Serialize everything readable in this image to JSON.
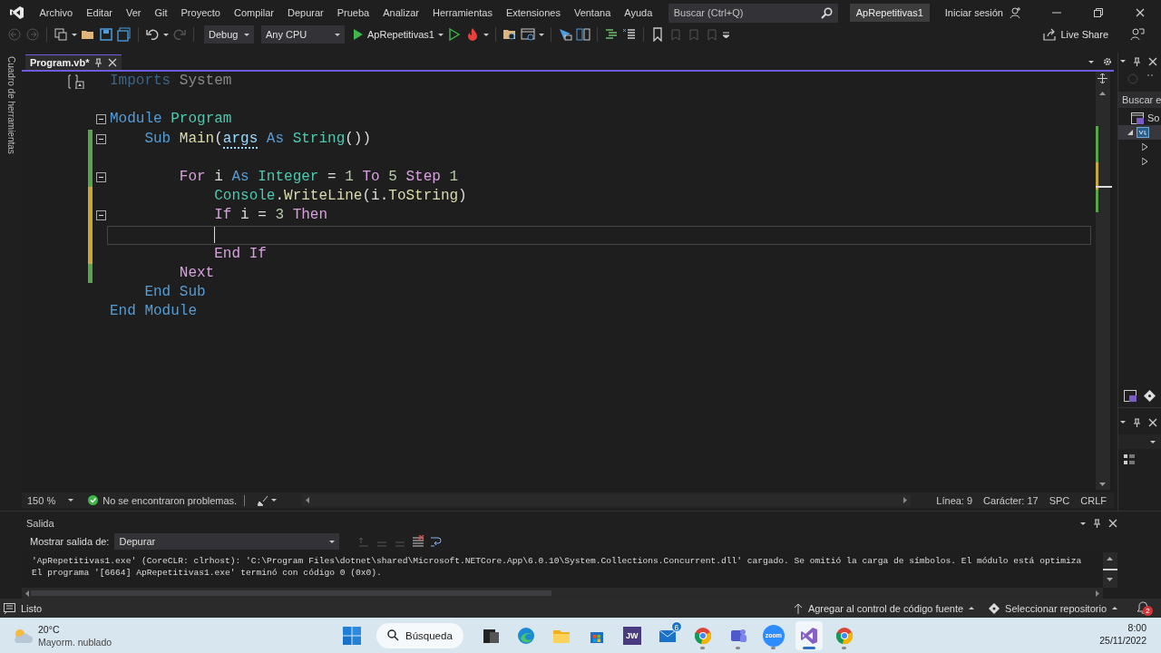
{
  "title_bar": {
    "menu": [
      "Archivo",
      "Editar",
      "Ver",
      "Git",
      "Proyecto",
      "Compilar",
      "Depurar",
      "Prueba",
      "Analizar",
      "Herramientas",
      "Extensiones",
      "Ventana",
      "Ayuda"
    ],
    "search": {
      "placeholder": "Buscar (Ctrl+Q)"
    },
    "solution_name": "ApRepetitivas1",
    "sign_in": "Iniciar sesión"
  },
  "toolbar": {
    "configuration": "Debug",
    "platform": "Any CPU",
    "start_target": "ApRepetitivas1",
    "live_share": "Live Share"
  },
  "toolbox_strip": {
    "label": "Cuadro de herramientas"
  },
  "editor": {
    "tabs": [
      {
        "label": "Program.vb*",
        "selected": true
      }
    ],
    "lines": [
      {
        "tokens": [
          {
            "text": "Imports ",
            "kind": "kw"
          },
          {
            "text": "System",
            "kind": "ident"
          }
        ],
        "unused": true,
        "quick_action": true
      },
      {
        "tokens": [
          {
            "text": "Module ",
            "kind": "kw"
          },
          {
            "text": "Program",
            "kind": "type"
          }
        ],
        "collapsed": false,
        "blank_before": true
      },
      {
        "tokens": [
          {
            "text": "    Sub ",
            "kind": "kw"
          },
          {
            "text": "Main",
            "kind": "func"
          },
          {
            "text": "(",
            "kind": "punct"
          },
          {
            "text": "args",
            "kind": "param"
          },
          {
            "text": " As ",
            "kind": "kw"
          },
          {
            "text": "String",
            "kind": "type"
          },
          {
            "text": "())",
            "kind": "punct"
          }
        ],
        "collapsed": false,
        "changed": true,
        "saved": true
      },
      {
        "tokens": [
          {
            "text": "        For ",
            "kind": "ctrl"
          },
          {
            "text": "i",
            "kind": "ident"
          },
          {
            "text": " As ",
            "kind": "kw"
          },
          {
            "text": "Integer",
            "kind": "type"
          },
          {
            "text": " = ",
            "kind": "punct"
          },
          {
            "text": "1",
            "kind": "num"
          },
          {
            "text": " To ",
            "kind": "ctrl"
          },
          {
            "text": "5",
            "kind": "num"
          },
          {
            "text": " Step ",
            "kind": "ctrl"
          },
          {
            "text": "1",
            "kind": "num"
          }
        ],
        "collapsed": false,
        "changed": true,
        "saved": true,
        "blank_before": true
      },
      {
        "tokens": [
          {
            "text": "            Console",
            "kind": "type"
          },
          {
            "text": ".",
            "kind": "punct"
          },
          {
            "text": "WriteLine",
            "kind": "func"
          },
          {
            "text": "(",
            "kind": "punct"
          },
          {
            "text": "i",
            "kind": "ident"
          },
          {
            "text": ".",
            "kind": "punct"
          },
          {
            "text": "ToString",
            "kind": "func"
          },
          {
            "text": ")",
            "kind": "punct"
          }
        ],
        "changed": true,
        "saved": false
      },
      {
        "tokens": [
          {
            "text": "            If ",
            "kind": "ctrl"
          },
          {
            "text": "i",
            "kind": "ident"
          },
          {
            "text": " = ",
            "kind": "punct"
          },
          {
            "text": "3",
            "kind": "num"
          },
          {
            "text": " Then",
            "kind": "ctrl"
          }
        ],
        "collapsed": false,
        "changed": true,
        "saved": false
      },
      {
        "changed": true,
        "saved": false,
        "current": true
      },
      {
        "tokens": [
          {
            "text": "            End If",
            "kind": "ctrl"
          }
        ],
        "changed": true,
        "saved": false
      },
      {
        "tokens": [
          {
            "text": "        Next",
            "kind": "ctrl"
          }
        ],
        "changed": true,
        "saved": true
      },
      {
        "tokens": [
          {
            "text": "    End Sub",
            "kind": "kw"
          }
        ]
      },
      {
        "tokens": [
          {
            "text": "End Module",
            "kind": "kw"
          }
        ]
      }
    ],
    "zoom": "150 %",
    "issues": "No se encontraron problemas.",
    "line": "Línea: 9",
    "column": "Carácter: 17",
    "indentation": "SPC",
    "line_endings": "CRLF"
  },
  "solution_explorer": {
    "search_placeholder": "Buscar e",
    "tree": [
      {
        "label": "So",
        "selected": false,
        "children": [
          {
            "expanded": true,
            "selected": true,
            "children": [
              {
                "expanded": false,
                "selected": false
              },
              {
                "expanded": false,
                "selected": false
              }
            ]
          }
        ]
      }
    ]
  },
  "output": {
    "title": "Salida",
    "source_label": "Mostrar salida de:",
    "source": "Depurar",
    "lines": [
      "'ApRepetitivas1.exe' (CoreCLR: clrhost): 'C:\\Program Files\\dotnet\\shared\\Microsoft.NETCore.App\\6.0.10\\System.Collections.Concurrent.dll' cargado. Se omitió la carga de símbolos. El módulo está optimiza",
      "El programa '[6664] ApRepetitivas1.exe' terminó con código 0 (0x0)."
    ]
  },
  "status_bar": {
    "state": "Listo",
    "source_control": "Agregar al control de código fuente",
    "repository": "Seleccionar repositorio",
    "notifications": "2"
  },
  "taskbar": {
    "weather": {
      "temperature": "20°C",
      "condition": "Mayorm. nublado"
    },
    "search": "Búsqueda",
    "apps": [
      {
        "kind": "task-view",
        "running": false,
        "selected": false
      },
      {
        "kind": "edge",
        "running": false,
        "selected": false
      },
      {
        "kind": "explorer",
        "running": false,
        "selected": false
      },
      {
        "kind": "store",
        "running": false,
        "selected": false
      },
      {
        "kind": "jw",
        "label": "JW",
        "running": false,
        "selected": false
      },
      {
        "kind": "mail",
        "badge": "6",
        "running": false,
        "selected": false
      },
      {
        "kind": "chrome",
        "running": true,
        "selected": false
      },
      {
        "kind": "teams",
        "running": true,
        "selected": false
      },
      {
        "kind": "zoom",
        "label": "zoom",
        "running": true,
        "selected": false
      },
      {
        "kind": "visual-studio",
        "running": true,
        "selected": true
      },
      {
        "kind": "chrome",
        "running": true,
        "selected": false
      }
    ],
    "time": "8:00",
    "date": "25/11/2022"
  }
}
